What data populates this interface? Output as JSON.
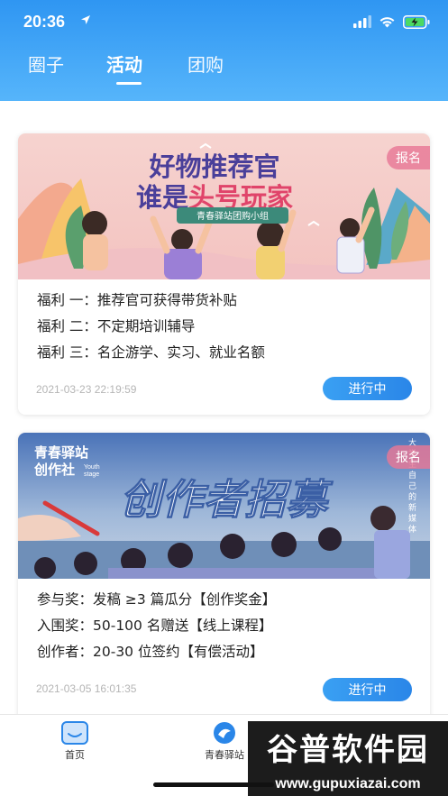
{
  "status_bar": {
    "time": "20:36"
  },
  "tabs": [
    {
      "label": "圈子",
      "active": false
    },
    {
      "label": "活动",
      "active": true
    },
    {
      "label": "团购",
      "active": false
    }
  ],
  "cards": [
    {
      "banner": {
        "title_line1": "好物推荐官",
        "title_line2_a": "谁是",
        "title_line2_b": "头号玩家",
        "subtitle": "青春驿站团购小组"
      },
      "badge": "报名",
      "perks": [
        "福利 一：推荐官可获得带货补贴",
        "福利 二：不定期培训辅导",
        "福利 三：名企游学、实习、就业名额"
      ],
      "date": "2021-03-23 22:19:59",
      "status": "进行中"
    },
    {
      "banner": {
        "brand_line1": "青春驿站",
        "brand_line2": "创作社",
        "brand_en1": "Youth",
        "brand_en2": "stage",
        "headline": "创作者招募",
        "vertical_text": "大学生自己的新媒体"
      },
      "badge": "报名",
      "perks": [
        "参与奖：发稿 ≥3 篇瓜分【创作奖金】",
        "入围奖：50-100 名赠送【线上课程】",
        "创作者：20-30 位签约【有偿活动】"
      ],
      "date": "2021-03-05 16:01:35",
      "status": "进行中"
    }
  ],
  "tabbar": [
    {
      "label": "首页",
      "icon": "home-icon"
    },
    {
      "label": "青春驿站",
      "icon": "fish-logo-icon"
    },
    {
      "label": "",
      "icon": "profile-icon"
    }
  ],
  "watermark": {
    "top": "谷普软件园",
    "bottom": "www.gupuxiazai.com"
  },
  "colors": {
    "header_top": "#2f96f2",
    "header_bottom": "#56b5fb",
    "accent_blue": "#2a86e8",
    "badge_pink": "#e87896"
  }
}
